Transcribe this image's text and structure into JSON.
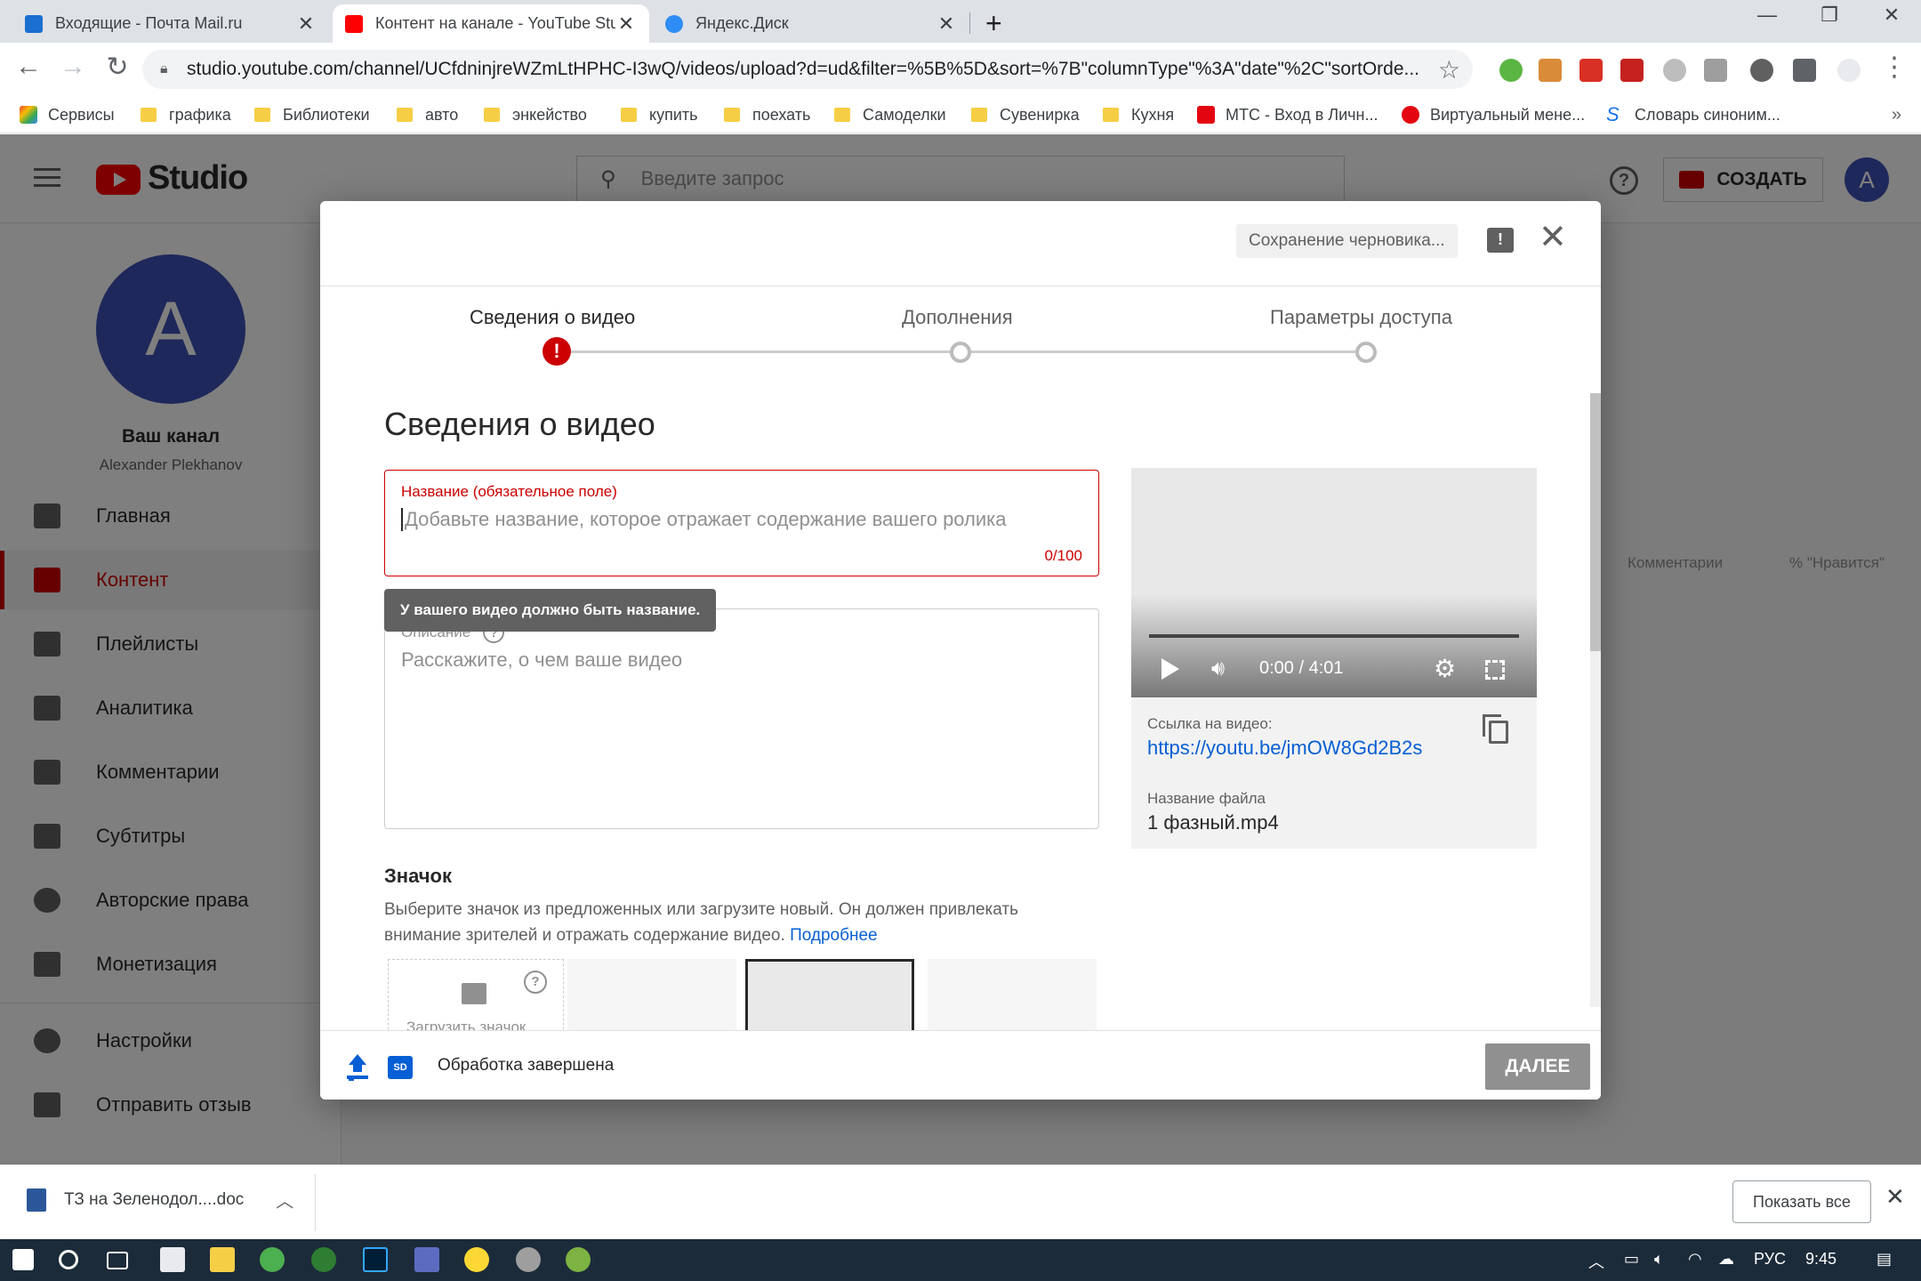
{
  "browser": {
    "tabs": [
      {
        "title": "Входящие - Почта Mail.ru",
        "favicon_color": "#1a6fd1"
      },
      {
        "title": "Контент на канале - YouTube Studio",
        "favicon_color": "#ff0000"
      },
      {
        "title": "Яндекс.Диск",
        "favicon_color": "#2e8df5"
      }
    ],
    "url": "studio.youtube.com/channel/UCfdninjreWZmLtHPHC-I3wQ/videos/upload?d=ud&filter=%5B%5D&sort=%7B\"columnType\"%3A\"date\"%2C\"sortOrde...",
    "bookmarks": [
      "Сервисы",
      "графика",
      "Библиотеки",
      "авто",
      "энкейство",
      "купить",
      "поехать",
      "Самоделки",
      "Сувенирка",
      "Кухня",
      "МТС - Вход в Личн...",
      "Виртуальный мене...",
      "Словарь синоним..."
    ]
  },
  "studio": {
    "logo_text": "Studio",
    "search_placeholder": "Введите запрос",
    "create_label": "СОЗДАТЬ",
    "avatar_letter": "A",
    "channel_label": "Ваш канал",
    "channel_name": "Alexander Plekhanov",
    "nav": [
      {
        "label": "Главная",
        "icon": "dashboard-icon"
      },
      {
        "label": "Контент",
        "icon": "content-icon",
        "active": true
      },
      {
        "label": "Плейлисты",
        "icon": "playlist-icon"
      },
      {
        "label": "Аналитика",
        "icon": "analytics-icon"
      },
      {
        "label": "Комментарии",
        "icon": "comments-icon"
      },
      {
        "label": "Субтитры",
        "icon": "subtitles-icon"
      },
      {
        "label": "Авторские права",
        "icon": "copyright-icon"
      },
      {
        "label": "Монетизация",
        "icon": "dollar-icon"
      },
      {
        "label": "Настройки",
        "icon": "gear-icon"
      },
      {
        "label": "Отправить отзыв",
        "icon": "feedback-icon"
      }
    ],
    "columns": [
      "Комментарии",
      "% \"Нравится\""
    ]
  },
  "modal": {
    "draft_status": "Сохранение черновика...",
    "steps": [
      "Сведения о видео",
      "Дополнения",
      "Параметры доступа"
    ],
    "section_title": "Сведения о видео",
    "title_field": {
      "label": "Название (обязательное поле)",
      "placeholder": "Добавьте название, которое отражает содержание вашего ролика",
      "counter": "0/100"
    },
    "tooltip": "У вашего видео должно быть название.",
    "description_field": {
      "label": "Описание",
      "placeholder": "Расскажите, о чем ваше видео"
    },
    "preview": {
      "time": "0:00 / 4:01",
      "link_label": "Ссылка на видео:",
      "link": "https://youtu.be/jmOW8Gd2B2s",
      "file_label": "Название файла",
      "file_name": "1 фазный.mp4"
    },
    "thumbnail": {
      "title": "Значок",
      "description": "Выберите значок из предложенных или загрузите новый. Он должен привлекать внимание зрителей и отражать содержание видео.",
      "more_link": "Подробнее",
      "upload_label": "Загрузить значок"
    },
    "footer": {
      "sd_badge": "SD",
      "status": "Обработка завершена",
      "next_label": "ДАЛЕЕ"
    }
  },
  "downloads": {
    "file": "ТЗ на  Зеленодол....doc",
    "show_all": "Показать все"
  },
  "taskbar": {
    "lang": "РУС",
    "time": "9:45"
  }
}
